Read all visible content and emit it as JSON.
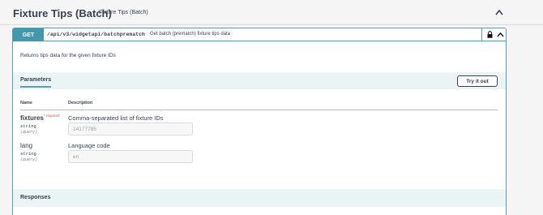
{
  "tag": {
    "title": "Fixture Tips (Batch)",
    "description": "Fixture Tips (Batch)"
  },
  "operation": {
    "method": "GET",
    "path": "/api/v3/widgetapi/batchprematch",
    "summary": "Get batch (prematch) fixture tips data",
    "description": "Returns tips data for the given fixture IDs"
  },
  "parameters_section": {
    "title": "Parameters",
    "try_button": "Try it out",
    "column_name": "Name",
    "column_description": "Description"
  },
  "parameters": [
    {
      "name": "fixtures",
      "required_label": "* required",
      "type": "string",
      "in": "(query)",
      "description": "Comma-separated list of fixture IDs",
      "placeholder": "14177785"
    },
    {
      "name": "lang",
      "type": "string",
      "in": "(query)",
      "description": "Language code",
      "placeholder": "en"
    }
  ],
  "responses_section": {
    "title": "Responses"
  },
  "colors": {
    "get_accent": "#4299ae",
    "get_border": "#4fa4b3",
    "section_bg": "#eaf4f5",
    "required": "#e04a4a"
  },
  "icons": {
    "collapse": "chevron-up-icon",
    "lock": "lock-icon",
    "expand": "chevron-up-icon"
  }
}
